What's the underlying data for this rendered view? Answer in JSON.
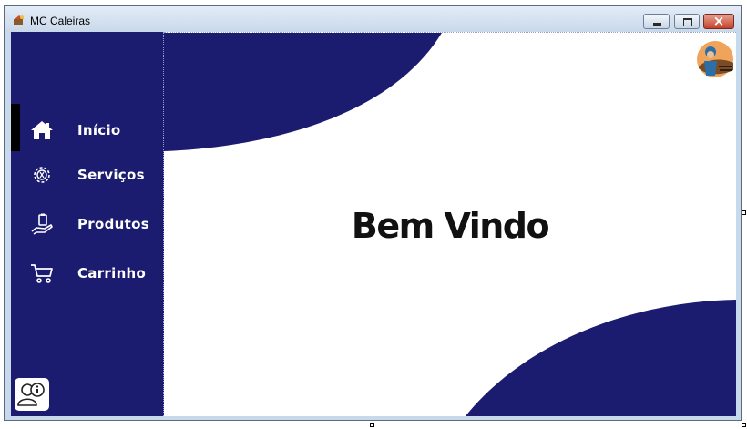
{
  "window": {
    "title": "MC Caleiras"
  },
  "sidebar": {
    "items": [
      {
        "label": "Início",
        "icon": "home-icon"
      },
      {
        "label": "Serviços",
        "icon": "gear-icon"
      },
      {
        "label": "Produtos",
        "icon": "product-hand-icon"
      },
      {
        "label": "Carrinho",
        "icon": "cart-icon"
      }
    ],
    "help_icon": "user-info-icon"
  },
  "main": {
    "welcome": "Bem Vindo",
    "logo": "worker-logo"
  },
  "colors": {
    "primary": "#1b1b70",
    "background": "#ffffff",
    "text": "#111111"
  }
}
